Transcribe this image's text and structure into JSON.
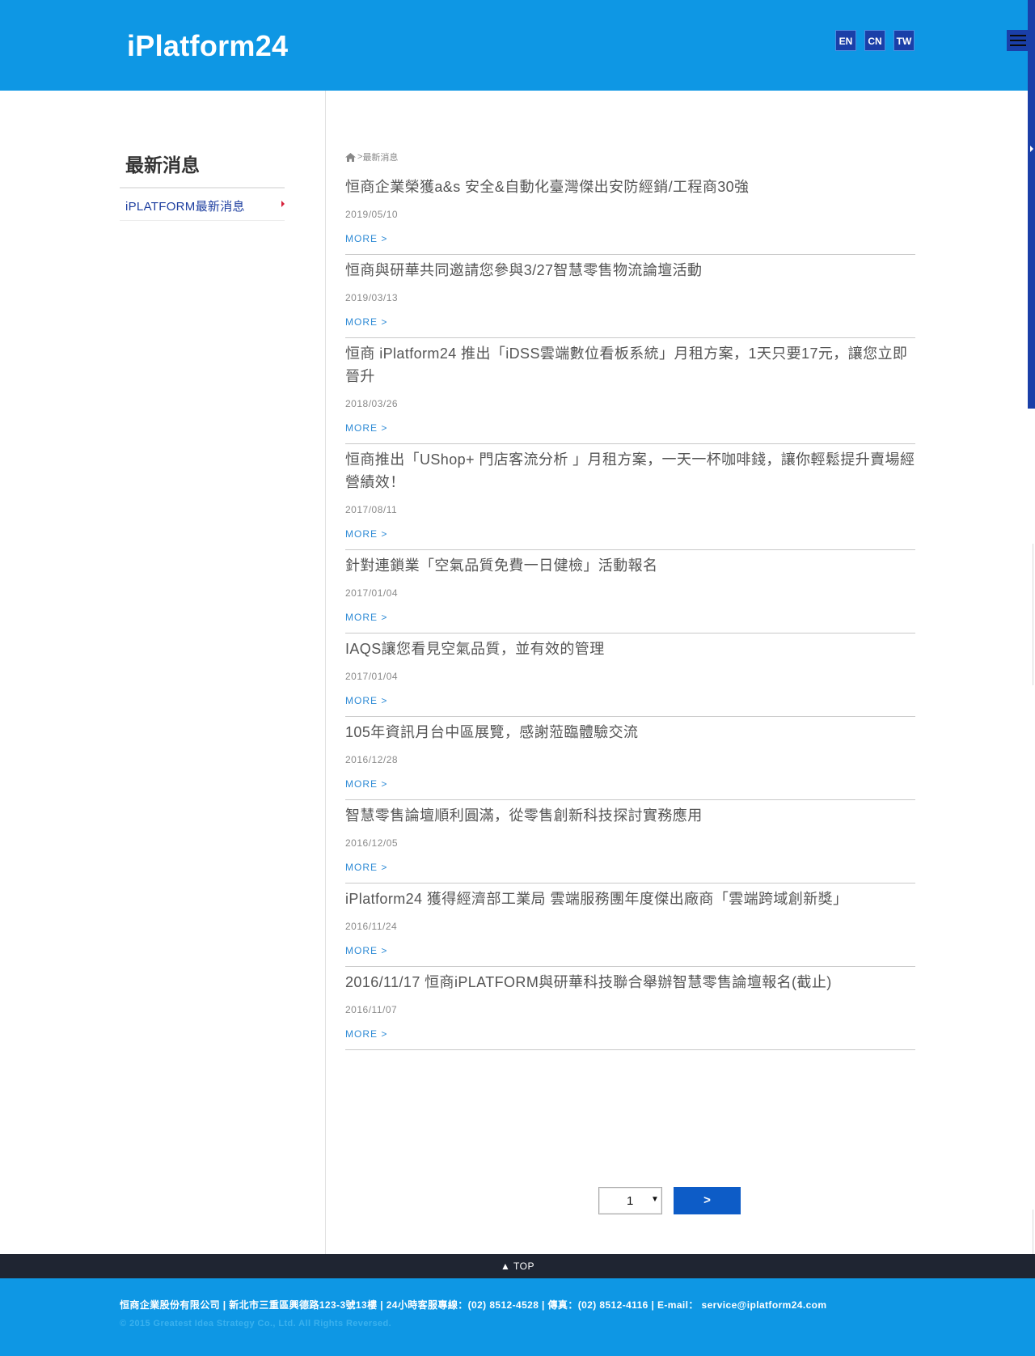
{
  "header": {
    "logo": "iPlatform24",
    "languages": [
      "EN",
      "CN",
      "TW"
    ]
  },
  "sidebar": {
    "title": "最新消息",
    "items": [
      {
        "label": "iPLATFORM最新消息"
      }
    ]
  },
  "breadcrumb": {
    "separator": ">",
    "current": "最新消息"
  },
  "news": [
    {
      "title": "恒商企業榮獲a&s 安全&自動化臺灣傑出安防經銷/工程商30強",
      "date": "2019/05/10",
      "more": "MORE >"
    },
    {
      "title": "恒商與研華共同邀請您參與3/27智慧零售物流論壇活動",
      "date": "2019/03/13",
      "more": "MORE >"
    },
    {
      "title": "恒商 iPlatform24 推出「iDSS雲端數位看板系統」月租方案，1天只要17元，讓您立即晉升",
      "date": "2018/03/26",
      "more": "MORE >"
    },
    {
      "title": "恒商推出「UShop+ 門店客流分析 」月租方案，一天一杯咖啡錢，讓你輕鬆提升賣場經營績效！",
      "date": "2017/08/11",
      "more": "MORE >"
    },
    {
      "title": "針對連鎖業「空氣品質免費一日健檢」活動報名",
      "date": "2017/01/04",
      "more": "MORE >"
    },
    {
      "title": "IAQS讓您看見空氣品質，並有效的管理",
      "date": "2017/01/04",
      "more": "MORE >"
    },
    {
      "title": "105年資訊月台中區展覽，感謝蒞臨體驗交流",
      "date": "2016/12/28",
      "more": "MORE >"
    },
    {
      "title": "智慧零售論壇順利圓滿，從零售創新科技探討實務應用",
      "date": "2016/12/05",
      "more": "MORE >"
    },
    {
      "title": "iPlatform24 獲得經濟部工業局 雲端服務團年度傑出廠商「雲端跨域創新獎」",
      "date": "2016/11/24",
      "more": "MORE >"
    },
    {
      "title": "2016/11/17 恒商iPLATFORM與研華科技聯合舉辦智慧零售論壇報名(截止)",
      "date": "2016/11/07",
      "more": "MORE >"
    }
  ],
  "pagination": {
    "page": "1",
    "caret": "▼",
    "next": ">"
  },
  "top_button": "▲ TOP",
  "footer": {
    "info": "恒商企業股份有限公司 | 新北市三重區興德路123-3號13樓 | 24小時客服專線：(02) 8512-4528 | 傳真：(02) 8512-4116 | E-mail： service@iplatform24.com",
    "copyright": "© 2015 Greatest Idea Strategy Co., Ltd. All Rights Reversed."
  },
  "colors": {
    "brand": "#0e97e4",
    "accent": "#1a3fa8",
    "link": "#2f8bd6",
    "arrow": "#d6203a"
  }
}
